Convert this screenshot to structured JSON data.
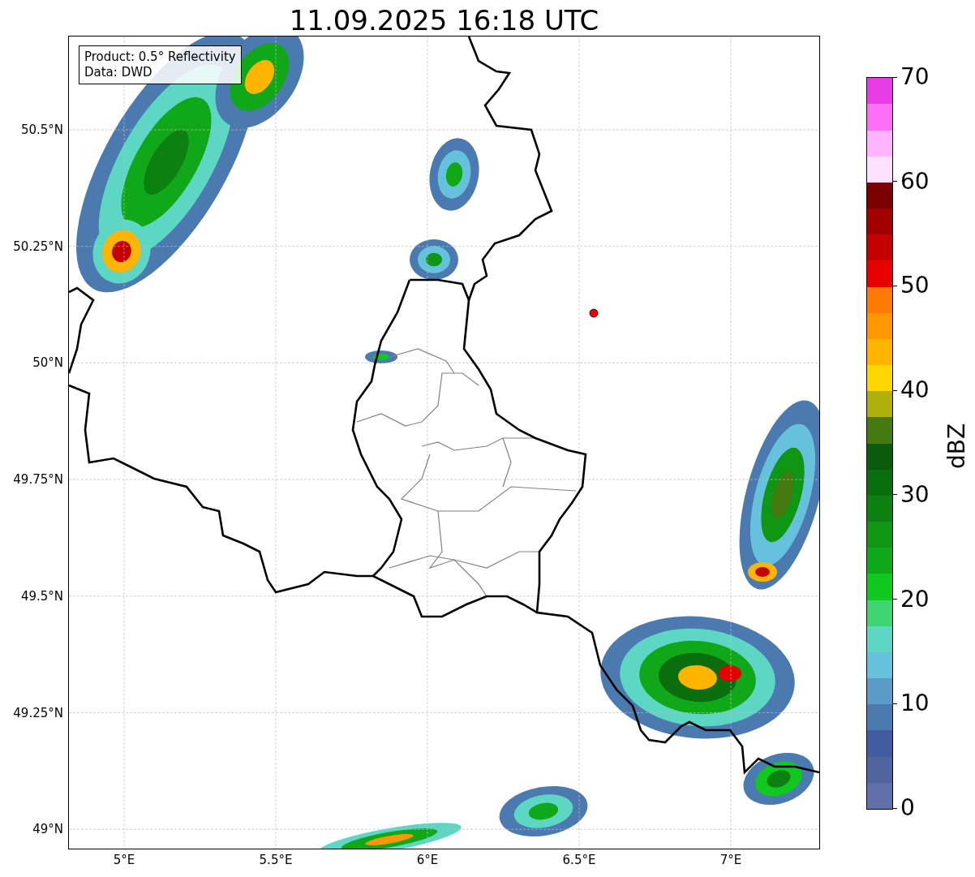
{
  "title": "11.09.2025 16:18 UTC",
  "info_box": {
    "lines": [
      "Product: 0.5° Reflectivity",
      "Data: DWD"
    ]
  },
  "map": {
    "y_ticks": [
      "50.5°N",
      "50.25°N",
      "50°N",
      "49.75°N",
      "49.5°N",
      "49.25°N",
      "49°N"
    ],
    "x_ticks": [
      "5°E",
      "5.5°E",
      "6°E",
      "6.5°E",
      "7°E"
    ]
  },
  "colorbar": {
    "label": "dBZ",
    "ticks": [
      "70",
      "60",
      "50",
      "40",
      "30",
      "20",
      "10",
      "0"
    ],
    "bins": [
      {
        "color": "#6070a8"
      },
      {
        "color": "#50659f"
      },
      {
        "color": "#415ca0"
      },
      {
        "color": "#4a7ab0"
      },
      {
        "color": "#5a9cc8"
      },
      {
        "color": "#66c2dc"
      },
      {
        "color": "#5dd6c4"
      },
      {
        "color": "#3dd670"
      },
      {
        "color": "#10c820"
      },
      {
        "color": "#10a818"
      },
      {
        "color": "#0e9614"
      },
      {
        "color": "#0c8010"
      },
      {
        "color": "#0a6e0e"
      },
      {
        "color": "#0a5c0c"
      },
      {
        "color": "#457a10"
      },
      {
        "color": "#b0b00a"
      },
      {
        "color": "#ffd700"
      },
      {
        "color": "#ffb400"
      },
      {
        "color": "#ff9800"
      },
      {
        "color": "#ff7a00"
      },
      {
        "color": "#e60000"
      },
      {
        "color": "#c40000"
      },
      {
        "color": "#a00000"
      },
      {
        "color": "#7c0000"
      },
      {
        "color": "#ffe0ff"
      },
      {
        "color": "#ffb4ff"
      },
      {
        "color": "#ff6ef6"
      },
      {
        "color": "#e83ce8"
      }
    ]
  }
}
